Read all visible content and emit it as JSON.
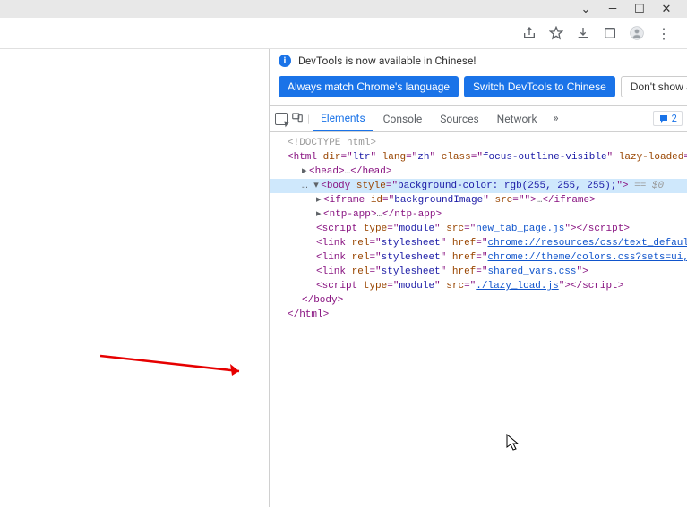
{
  "titlebar": {
    "minimize": "—",
    "maximize": "☐",
    "close": "✕",
    "chevron": "⌄"
  },
  "toolbar": {
    "share": "share",
    "star": "star",
    "download": "download",
    "tabview": "tabview",
    "profile": "profile",
    "menu": "⋮"
  },
  "infobar": {
    "text": "DevTools is now available in Chinese!",
    "close": "✕"
  },
  "buttons": {
    "match": "Always match Chrome's language",
    "switch": "Switch DevTools to Chinese",
    "dismiss": "Don't show again"
  },
  "tabs": {
    "elements": "Elements",
    "console": "Console",
    "sources": "Sources",
    "network": "Network",
    "more": "»",
    "issues_count": "2",
    "kebab": "⋮",
    "close": "✕"
  },
  "dom": {
    "doctype": "<!DOCTYPE html>",
    "html_open": {
      "tag": "html",
      "attrs": [
        [
          "dir",
          "ltr"
        ],
        [
          "lang",
          "zh"
        ],
        [
          "class",
          "focus-outline-visible"
        ],
        [
          "lazy-loaded",
          "true"
        ]
      ]
    },
    "head": {
      "tag": "head",
      "ellipsis": "…"
    },
    "body_open": {
      "prefix": "…",
      "tag": "body",
      "attrs": [
        [
          "style",
          "background-color: rgb(255, 255, 255);"
        ]
      ],
      "trailer": " == $0"
    },
    "iframe": {
      "tag": "iframe",
      "attrs": [
        [
          "id",
          "backgroundImage"
        ],
        [
          "src",
          ""
        ]
      ],
      "ellipsis": "…"
    },
    "ntp": {
      "tag": "ntp-app",
      "ellipsis": "…"
    },
    "script1": {
      "tag": "script",
      "attrs": [
        [
          "type",
          "module"
        ],
        [
          "src",
          "new_tab_page.js"
        ]
      ],
      "link_attr": "src"
    },
    "link1": {
      "tag": "link",
      "attrs": [
        [
          "rel",
          "stylesheet"
        ],
        [
          "href",
          "chrome://resources/css/text_defaults_md.css"
        ]
      ],
      "link_attr": "href"
    },
    "link2": {
      "tag": "link",
      "attrs": [
        [
          "rel",
          "stylesheet"
        ],
        [
          "href",
          "chrome://theme/colors.css?sets=ui,chrome"
        ]
      ],
      "link_attr": "href"
    },
    "link3": {
      "tag": "link",
      "attrs": [
        [
          "rel",
          "stylesheet"
        ],
        [
          "href",
          "shared_vars.css"
        ]
      ],
      "link_attr": "href"
    },
    "script2": {
      "tag": "script",
      "attrs": [
        [
          "type",
          "module"
        ],
        [
          "src",
          "./lazy_load.js"
        ]
      ],
      "link_attr": "src"
    },
    "body_close": "</body>",
    "html_close": "</html>"
  }
}
